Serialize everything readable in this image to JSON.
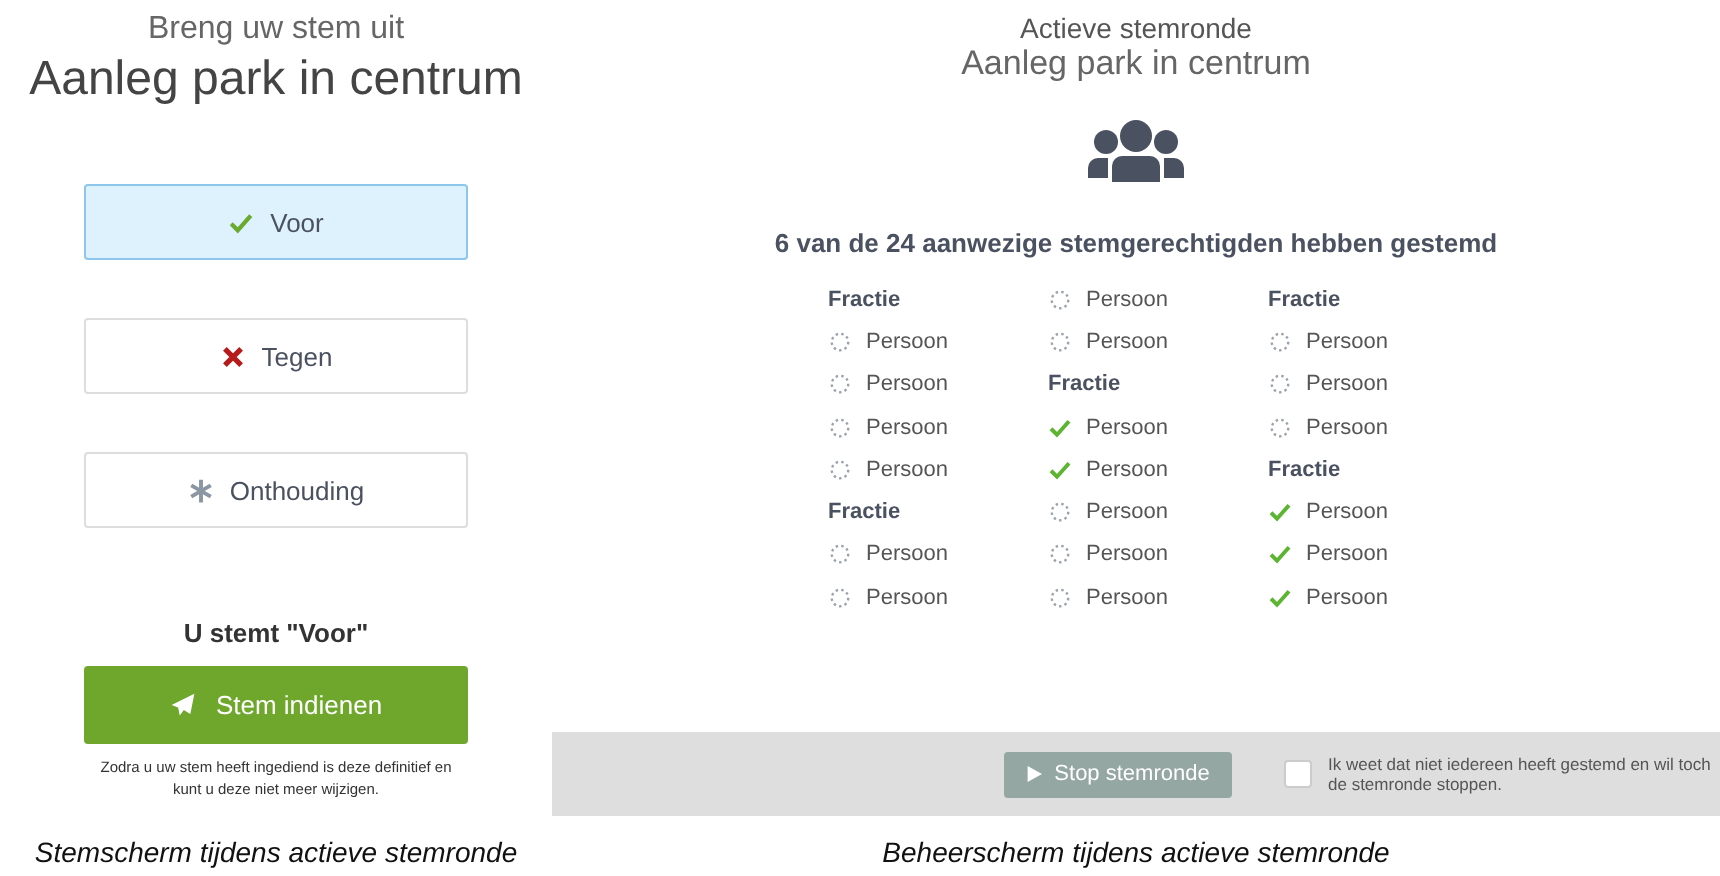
{
  "voting_screen": {
    "heading": "Breng uw stem uit",
    "title": "Aanleg park in centrum",
    "options": [
      {
        "label": "Voor",
        "kind": "for",
        "selected": true
      },
      {
        "label": "Tegen",
        "kind": "against",
        "selected": false
      },
      {
        "label": "Onthouding",
        "kind": "abstain",
        "selected": false
      }
    ],
    "choice_text": "U stemt \"Voor\"",
    "submit_button": "Stem indienen",
    "note": "Zodra u uw stem heeft ingediend is deze definitief en kunt u deze niet meer wijzigen.",
    "caption": "Stemscherm tijdens actieve stemronde"
  },
  "admin_screen": {
    "heading": "Actieve stemronde",
    "title": "Aanleg park in centrum",
    "summary": "6 van de 24 aanwezige stemgerechtigden hebben gestemd",
    "columns": [
      [
        {
          "kind": "group",
          "label": "Fractie"
        },
        {
          "kind": "person",
          "label": "Persoon",
          "voted": false
        },
        {
          "kind": "person",
          "label": "Persoon",
          "voted": false
        },
        {
          "kind": "person",
          "label": "Persoon",
          "voted": false
        },
        {
          "kind": "person",
          "label": "Persoon",
          "voted": false
        },
        {
          "kind": "group",
          "label": "Fractie"
        },
        {
          "kind": "person",
          "label": "Persoon",
          "voted": false
        },
        {
          "kind": "person",
          "label": "Persoon",
          "voted": false
        }
      ],
      [
        {
          "kind": "person",
          "label": "Persoon",
          "voted": false
        },
        {
          "kind": "person",
          "label": "Persoon",
          "voted": false
        },
        {
          "kind": "group",
          "label": "Fractie"
        },
        {
          "kind": "person",
          "label": "Persoon",
          "voted": true
        },
        {
          "kind": "person",
          "label": "Persoon",
          "voted": true
        },
        {
          "kind": "person",
          "label": "Persoon",
          "voted": false
        },
        {
          "kind": "person",
          "label": "Persoon",
          "voted": false
        },
        {
          "kind": "person",
          "label": "Persoon",
          "voted": false
        }
      ],
      [
        {
          "kind": "group",
          "label": "Fractie"
        },
        {
          "kind": "person",
          "label": "Persoon",
          "voted": false
        },
        {
          "kind": "person",
          "label": "Persoon",
          "voted": false
        },
        {
          "kind": "person",
          "label": "Persoon",
          "voted": false
        },
        {
          "kind": "group",
          "label": "Fractie"
        },
        {
          "kind": "person",
          "label": "Persoon",
          "voted": true
        },
        {
          "kind": "person",
          "label": "Persoon",
          "voted": true
        },
        {
          "kind": "person",
          "label": "Persoon",
          "voted": true
        }
      ]
    ],
    "stop_button": {
      "label": "Stop stemronde",
      "disabled": true
    },
    "confirm": {
      "label": "Ik weet dat niet iedereen heeft gestemd en wil toch de stemronde stoppen.",
      "checked": false
    },
    "caption": "Beheerscherm tijdens actieve stemronde"
  }
}
